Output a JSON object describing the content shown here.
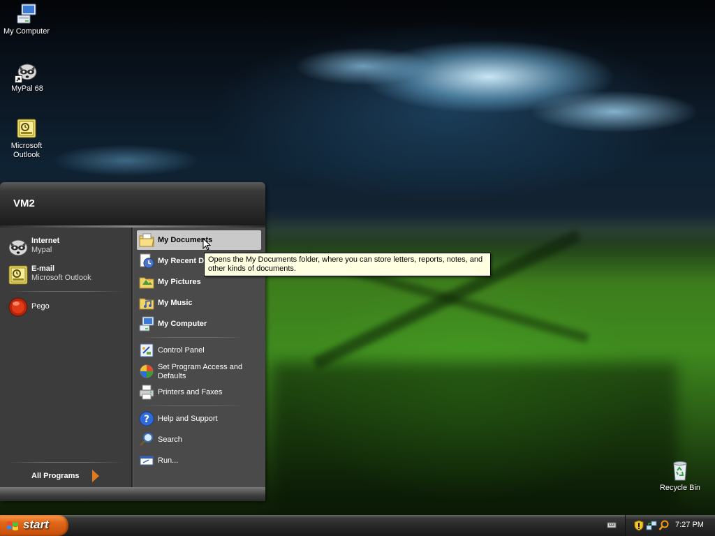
{
  "desktop": {
    "icons": [
      {
        "label": "My Computer",
        "icon": "my-computer-icon"
      },
      {
        "label": "MyPal 68",
        "icon": "mypal-raccoon-icon"
      },
      {
        "label": "Microsoft Outlook",
        "icon": "outlook-icon"
      },
      {
        "label": "Recycle Bin",
        "icon": "recycle-bin-icon"
      }
    ]
  },
  "start_menu": {
    "user_name": "VM2",
    "pinned": [
      {
        "title": "Internet",
        "subtitle": "Mypal",
        "icon": "mypal-raccoon-icon"
      },
      {
        "title": "E-mail",
        "subtitle": "Microsoft Outlook",
        "icon": "outlook-icon"
      }
    ],
    "recent": [
      {
        "label": "Pego",
        "icon": "pego-icon"
      }
    ],
    "all_programs": "All Programs",
    "right": {
      "places": [
        {
          "label": "My Documents",
          "icon": "my-documents-folder-icon"
        },
        {
          "label": "My Recent Documents",
          "icon": "recent-documents-icon"
        },
        {
          "label": "My Pictures",
          "icon": "my-pictures-folder-icon"
        },
        {
          "label": "My Music",
          "icon": "my-music-folder-icon"
        },
        {
          "label": "My Computer",
          "icon": "my-computer-icon"
        }
      ],
      "settings": [
        {
          "label": "Control Panel",
          "icon": "control-panel-icon"
        },
        {
          "label": "Set Program Access and Defaults",
          "icon": "program-access-icon"
        },
        {
          "label": "Printers and Faxes",
          "icon": "printer-icon"
        }
      ],
      "tools": [
        {
          "label": "Help and Support",
          "icon": "help-icon"
        },
        {
          "label": "Search",
          "icon": "search-icon"
        },
        {
          "label": "Run...",
          "icon": "run-icon"
        }
      ]
    },
    "tooltip": "Opens the My Documents folder, where you can store letters, reports, notes, and other kinds of documents."
  },
  "taskbar": {
    "start_label": "start",
    "clock": "7:27 PM",
    "tray_icons": [
      "keyboard-icon",
      "security-shield-icon",
      "network-icon",
      "search-tray-icon"
    ]
  },
  "colors": {
    "taskbar": "#262626",
    "start_button": "#e2681a",
    "menu_left": "#3c3c3c",
    "menu_right": "#4a4a4a",
    "tooltip_bg": "#ffffe1",
    "selection": "#c9c9c9"
  }
}
